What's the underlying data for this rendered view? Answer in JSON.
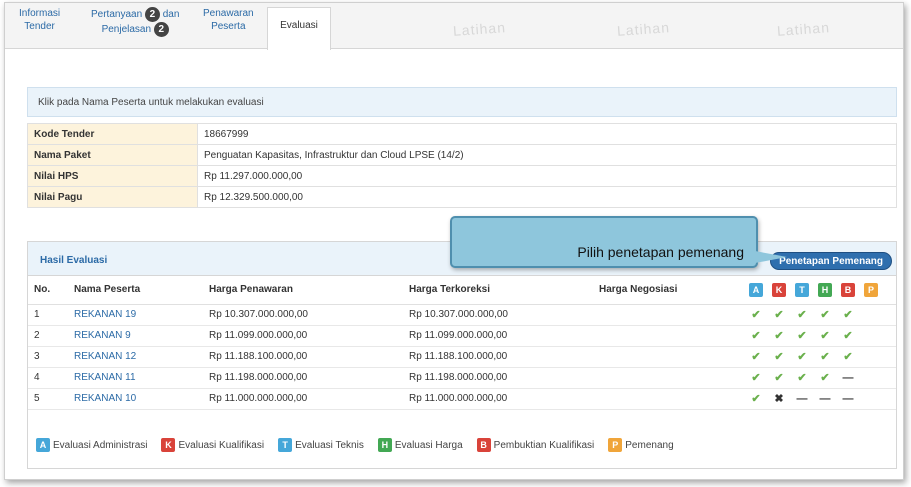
{
  "tabs": [
    {
      "line1": "Informasi",
      "line2": "Tender"
    },
    {
      "line1": "Pertanyaan",
      "badge1": "2",
      "line1b": "dan",
      "line2": "Penjelasan",
      "badge2": "2"
    },
    {
      "line1": "Penawaran",
      "line2": "Peserta"
    },
    {
      "label": "Evaluasi"
    }
  ],
  "watermark": "Latihan",
  "info": "Klik pada Nama Peserta untuk melakukan evaluasi",
  "details": [
    {
      "label": "Kode Tender",
      "value": "18667999"
    },
    {
      "label": "Nama Paket",
      "value": "Penguatan Kapasitas, Infrastruktur dan Cloud LPSE (14/2)"
    },
    {
      "label": "Nilai HPS",
      "value": "Rp 11.297.000.000,00"
    },
    {
      "label": "Nilai Pagu",
      "value": "Rp 12.329.500.000,00"
    }
  ],
  "panel": {
    "title": "Hasil Evaluasi",
    "button": "Penetapan Pemenang"
  },
  "callout": "Pilih penetapan pemenang",
  "columns": {
    "no": "No.",
    "name": "Nama Peserta",
    "offer": "Harga Penawaran",
    "corrected": "Harga Terkoreksi",
    "negotiated": "Harga Negosiasi"
  },
  "eval_codes": [
    "A",
    "K",
    "T",
    "H",
    "B",
    "P"
  ],
  "rows": [
    {
      "no": "1",
      "name": "REKANAN 19",
      "offer": "Rp 10.307.000.000,00",
      "corrected": "Rp 10.307.000.000,00",
      "negotiated": "",
      "marks": [
        "✔",
        "✔",
        "✔",
        "✔",
        "✔",
        ""
      ]
    },
    {
      "no": "2",
      "name": "REKANAN 9",
      "offer": "Rp 11.099.000.000,00",
      "corrected": "Rp 11.099.000.000,00",
      "negotiated": "",
      "marks": [
        "✔",
        "✔",
        "✔",
        "✔",
        "✔",
        ""
      ]
    },
    {
      "no": "3",
      "name": "REKANAN 12",
      "offer": "Rp 11.188.100.000,00",
      "corrected": "Rp 11.188.100.000,00",
      "negotiated": "",
      "marks": [
        "✔",
        "✔",
        "✔",
        "✔",
        "✔",
        ""
      ]
    },
    {
      "no": "4",
      "name": "REKANAN 11",
      "offer": "Rp 11.198.000.000,00",
      "corrected": "Rp 11.198.000.000,00",
      "negotiated": "",
      "marks": [
        "✔",
        "✔",
        "✔",
        "✔",
        "—",
        ""
      ]
    },
    {
      "no": "5",
      "name": "REKANAN 10",
      "offer": "Rp 11.000.000.000,00",
      "corrected": "Rp 11.000.000.000,00",
      "negotiated": "",
      "marks": [
        "✔",
        "✖",
        "—",
        "—",
        "—",
        ""
      ]
    }
  ],
  "legend": [
    {
      "code": "A",
      "label": "Evaluasi Administrasi"
    },
    {
      "code": "K",
      "label": "Evaluasi Kualifikasi"
    },
    {
      "code": "T",
      "label": "Evaluasi Teknis"
    },
    {
      "code": "H",
      "label": "Evaluasi Harga"
    },
    {
      "code": "B",
      "label": "Pembuktian Kualifikasi"
    },
    {
      "code": "P",
      "label": "Pemenang"
    }
  ]
}
